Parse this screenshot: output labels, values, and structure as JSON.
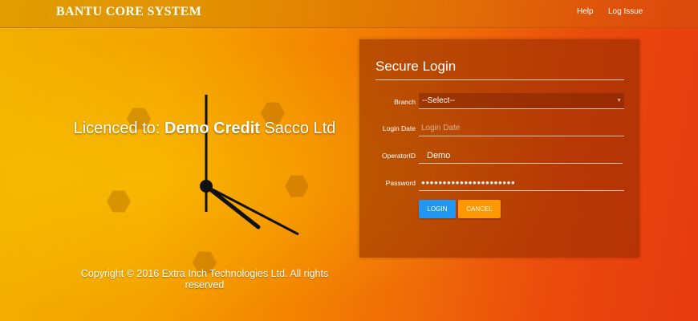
{
  "navbar": {
    "brand": "BANTU CORE SYSTEM",
    "links": [
      "Help",
      "Log Issue"
    ]
  },
  "hero": {
    "licence_prefix": "Licenced to: ",
    "licence_name": "Demo Credit",
    "licence_suffix": " Sacco Ltd",
    "copyright": "Copyright © 2016 Extra Inch Technologies Ltd. All rights reserved"
  },
  "login": {
    "title": "Secure Login",
    "branch_label": "Branch",
    "branch_value": "--Select--",
    "login_date_label": "Login Date",
    "login_date_placeholder": "Login Date",
    "operator_label": "OperatorID",
    "operator_value": "Demo",
    "password_label": "Password",
    "password_value": "●●●●●●●●●●●●●●●●●●●●●●",
    "login_button": "LOGIN",
    "cancel_button": "CANCEL"
  },
  "colors": {
    "login_button": "#2196f3",
    "cancel_button": "#ff9800"
  }
}
